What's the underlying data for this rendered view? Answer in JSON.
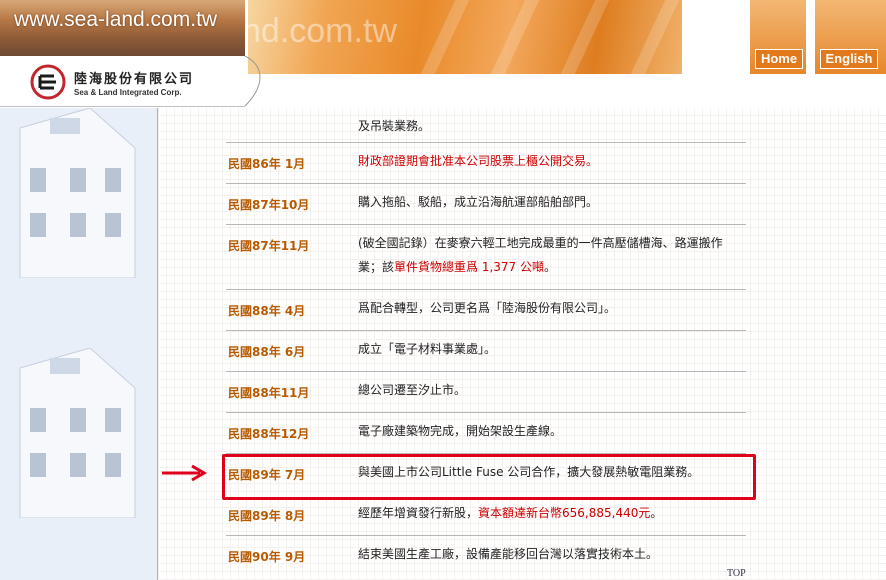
{
  "header": {
    "domain_text": "www.sea-land.com.tw",
    "ghost_domain": "nd.com.tw",
    "home_label": "Home",
    "english_label": "English"
  },
  "logo": {
    "name_zh": "陸海股份有限公司",
    "name_en": "Sea & Land Integrated Corp."
  },
  "rows": [
    {
      "date": "",
      "desc_plain": "及吊裝業務。",
      "desc_red": "",
      "desc_tail": ""
    },
    {
      "date": "民國86年 1月",
      "desc_plain": "",
      "desc_red": "財政部證期會批准本公司股票上櫃公開交易。",
      "desc_tail": ""
    },
    {
      "date": "民國87年10月",
      "desc_plain": "購入拖船、駁船，成立沿海航運部船舶部門。",
      "desc_red": "",
      "desc_tail": ""
    },
    {
      "date": "民國87年11月",
      "desc_plain": "(破全國記錄）在麥寮六輕工地完成最重的一件高壓儲槽海、路運搬作業；該",
      "desc_red": "單件貨物總重爲 1,377 公噸",
      "desc_tail": "。"
    },
    {
      "date": "民國88年 4月",
      "desc_plain": "爲配合轉型，公司更名爲「陸海股份有限公司」。",
      "desc_red": "",
      "desc_tail": ""
    },
    {
      "date": "民國88年 6月",
      "desc_plain": "成立「電子材料事業處」。",
      "desc_red": "",
      "desc_tail": ""
    },
    {
      "date": "民國88年11月",
      "desc_plain": "總公司遷至汐止市。",
      "desc_red": "",
      "desc_tail": ""
    },
    {
      "date": "民國88年12月",
      "desc_plain": "電子廠建築物完成，開始架設生產線。",
      "desc_red": "",
      "desc_tail": ""
    },
    {
      "date": "民國89年 7月",
      "desc_plain": "與美國上市公司Little Fuse 公司合作，擴大發展熱敏電阻業務。",
      "desc_red": "",
      "desc_tail": ""
    },
    {
      "date": "民國89年 8月",
      "desc_plain": "經歷年增資發行新股，",
      "desc_red": "資本額達新台幣656,885,440元",
      "desc_tail": "。"
    },
    {
      "date": "民國90年 9月",
      "desc_plain": "結束美國生產工廠，設備產能移回台灣以落實技術本土。",
      "desc_red": "",
      "desc_tail": ""
    }
  ],
  "footer": {
    "top_label": "TOP"
  },
  "colors": {
    "date": "#b85a00",
    "highlight": "#e0001a",
    "accent_red": "#cc0000",
    "orange": "#e98a2a"
  }
}
